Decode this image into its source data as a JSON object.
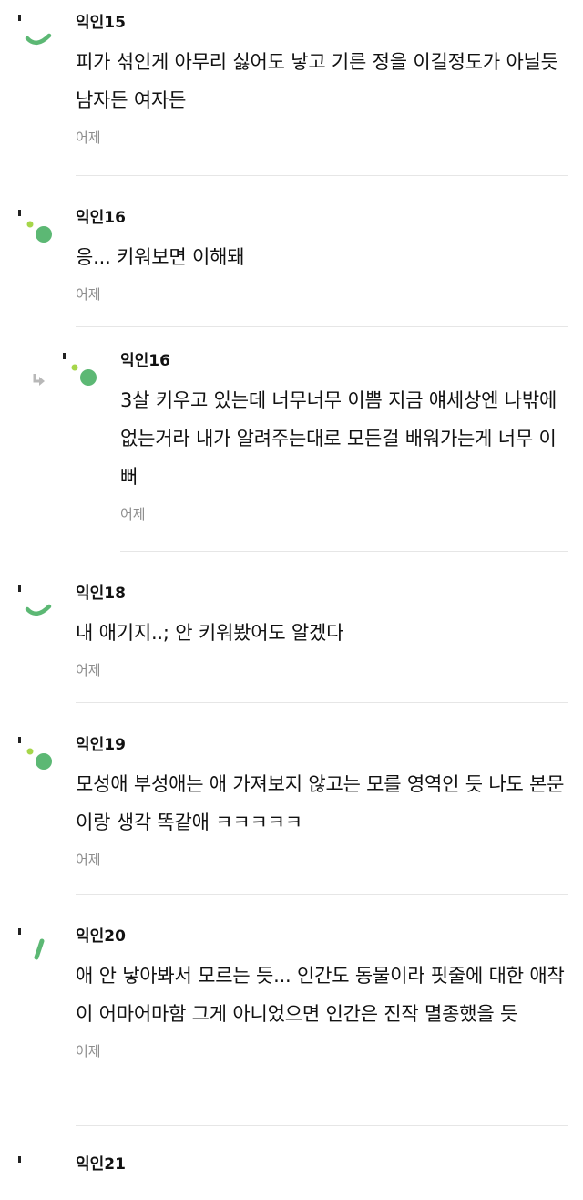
{
  "colors": {
    "avatar_green": "#5cb874",
    "avatar_lime": "#a6d64a",
    "divider": "#e6e6e6",
    "time_text": "#8e8e8e",
    "reply_arrow": "#b8b8b8"
  },
  "comments": [
    {
      "author": "익인15",
      "text": "피가 섞인게 아무리 싫어도 낳고 기른 정을 이길정도가 아닐듯 남자든 여자든",
      "time": "어제",
      "avatar": "arc-icon",
      "reply": false
    },
    {
      "author": "익인16",
      "text": "응... 키워보면 이해돼",
      "time": "어제",
      "avatar": "dots-icon",
      "reply": false
    },
    {
      "author": "익인16",
      "text": "3살 키우고 있는데 너무너무 이쁨 지금 얘세상엔 나밖에 없는거라 내가 알려주는대로 모든걸 배워가는게 너무 이뻐",
      "time": "어제",
      "avatar": "dots-icon",
      "reply": true
    },
    {
      "author": "익인18",
      "text": "내 애기지..; 안 키워봤어도 알겠다",
      "time": "어제",
      "avatar": "arc-icon",
      "reply": false
    },
    {
      "author": "익인19",
      "text": "모성애 부성애는 애 가져보지 않고는 모를 영역인 듯 나도 본문이랑 생각 똑같애 ㅋㅋㅋㅋㅋ",
      "time": "어제",
      "avatar": "dots-icon",
      "reply": false
    },
    {
      "author": "익인20",
      "text": "애 안 낳아봐서 모르는 듯... 인간도 동물이라 핏줄에 대한 애착이 어마어마함 그게 아니었으면 인간은 진작 멸종했을 듯",
      "time": "어제",
      "avatar": "slash-icon",
      "reply": false
    },
    {
      "author": "익인21",
      "text": "",
      "time": "",
      "avatar": "arc-icon",
      "reply": false
    }
  ]
}
